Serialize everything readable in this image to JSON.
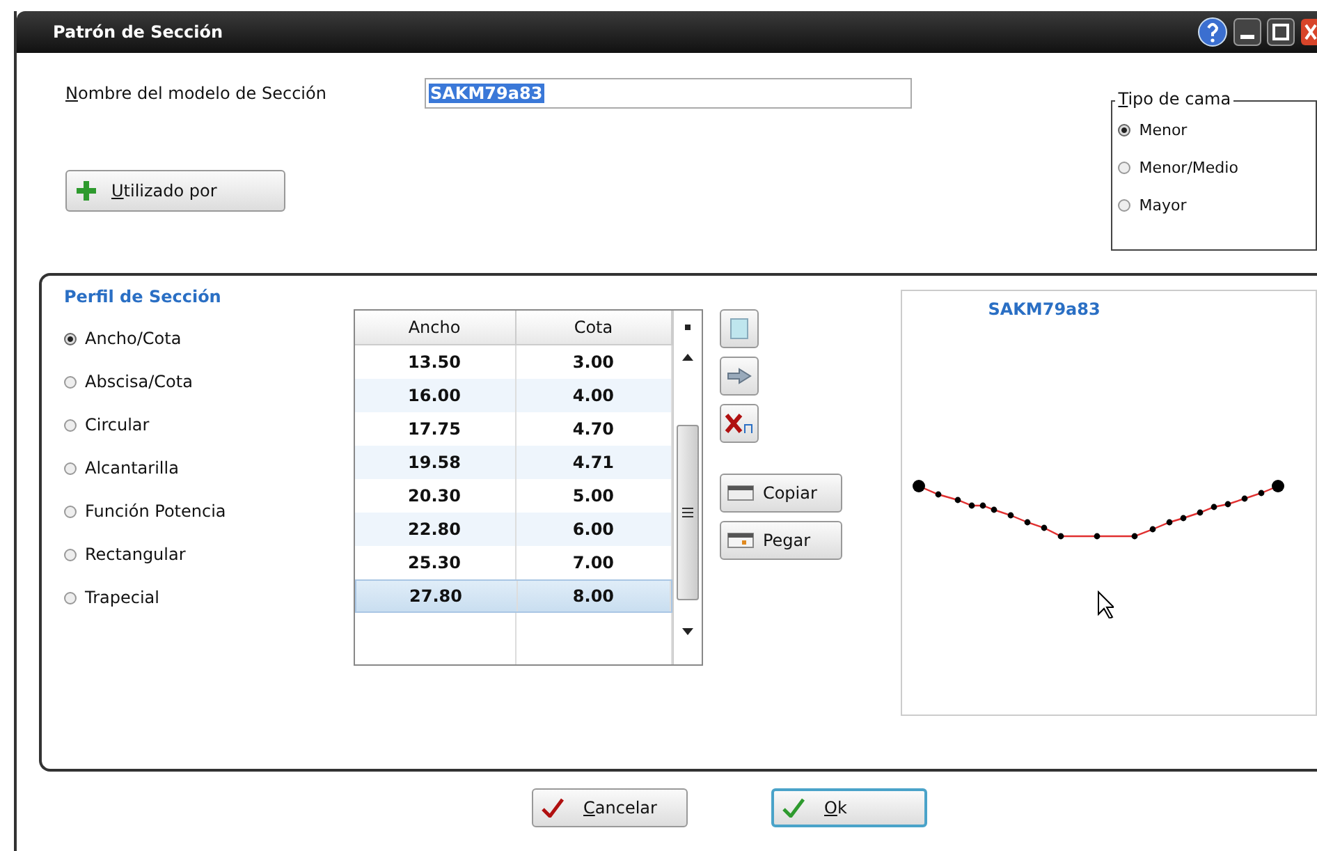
{
  "window": {
    "title": "Patrón de Sección"
  },
  "model_name": {
    "label": "Nombre del modelo de Sección",
    "value": "SAKM79a83"
  },
  "used_by_button": "Utilizado por",
  "bed_type": {
    "title": "Tipo de cama",
    "options": [
      {
        "label": "Menor",
        "selected": true
      },
      {
        "label": "Menor/Medio",
        "selected": false
      },
      {
        "label": "Mayor",
        "selected": false
      }
    ]
  },
  "profile": {
    "title": "Perfil de Sección",
    "options": [
      {
        "label": "Ancho/Cota",
        "selected": true
      },
      {
        "label": "Abscisa/Cota",
        "selected": false
      },
      {
        "label": "Circular",
        "selected": false
      },
      {
        "label": "Alcantarilla",
        "selected": false
      },
      {
        "label": "Función Potencia",
        "selected": false
      },
      {
        "label": "Rectangular",
        "selected": false
      },
      {
        "label": "Trapecial",
        "selected": false
      }
    ]
  },
  "table": {
    "columns": [
      "Ancho",
      "Cota"
    ],
    "rows": [
      {
        "cells": [
          "13.50",
          "3.00"
        ],
        "selected": false
      },
      {
        "cells": [
          "16.00",
          "4.00"
        ],
        "selected": false
      },
      {
        "cells": [
          "17.75",
          "4.70"
        ],
        "selected": false
      },
      {
        "cells": [
          "19.58",
          "4.71"
        ],
        "selected": false
      },
      {
        "cells": [
          "20.30",
          "5.00"
        ],
        "selected": false
      },
      {
        "cells": [
          "22.80",
          "6.00"
        ],
        "selected": false
      },
      {
        "cells": [
          "25.30",
          "7.00"
        ],
        "selected": false
      },
      {
        "cells": [
          "27.80",
          "8.00"
        ],
        "selected": true
      }
    ]
  },
  "tools": [
    {
      "label": "Copiar",
      "kind": "copy"
    },
    {
      "label": "Pegar",
      "kind": "paste"
    }
  ],
  "preview": {
    "title": "SAKM79a83"
  },
  "buttons": [
    {
      "label": "Cancelar",
      "kind": "cancel"
    },
    {
      "label": "Ok",
      "kind": "ok"
    }
  ]
}
